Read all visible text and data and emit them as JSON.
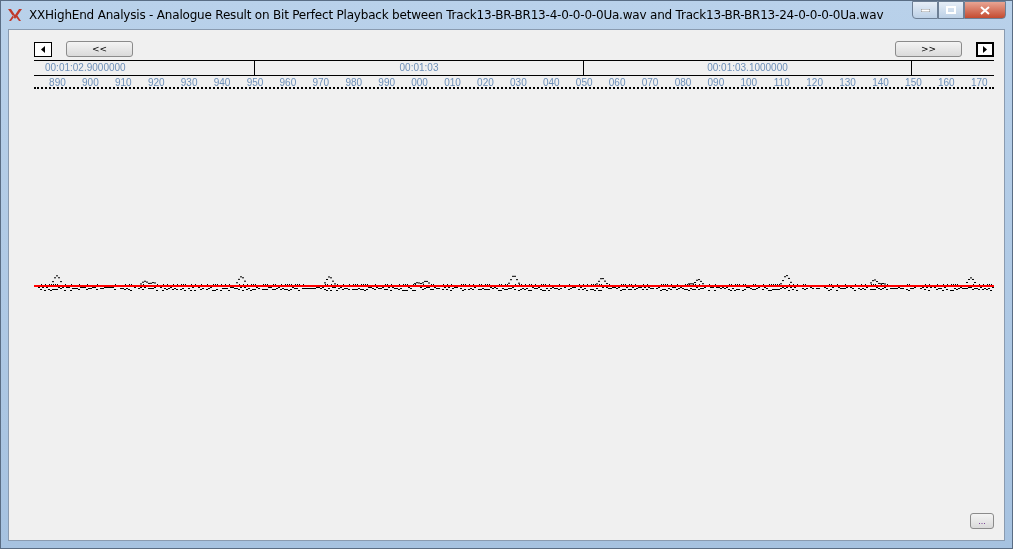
{
  "window": {
    "title": "XXHighEnd Analysis - Analogue Result on Bit Perfect Playback between Track13-BR-BR13-4-0-0-0-0Ua.wav and Track13-BR-BR13-24-0-0-0-0Ua.wav"
  },
  "navigation": {
    "back_label": "<<",
    "forward_label": ">>"
  },
  "time_ruler": [
    "00:01:02.9000000",
    "00:01:03",
    "00:01:03.1000000"
  ],
  "tick_labels": [
    "890",
    "900",
    "910",
    "920",
    "930",
    "940",
    "950",
    "960",
    "970",
    "980",
    "990",
    "000",
    "010",
    "020",
    "030",
    "040",
    "050",
    "060",
    "070",
    "080",
    "090",
    "100",
    "110",
    "120",
    "130",
    "140",
    "150",
    "160",
    "170"
  ],
  "more_button": "..."
}
